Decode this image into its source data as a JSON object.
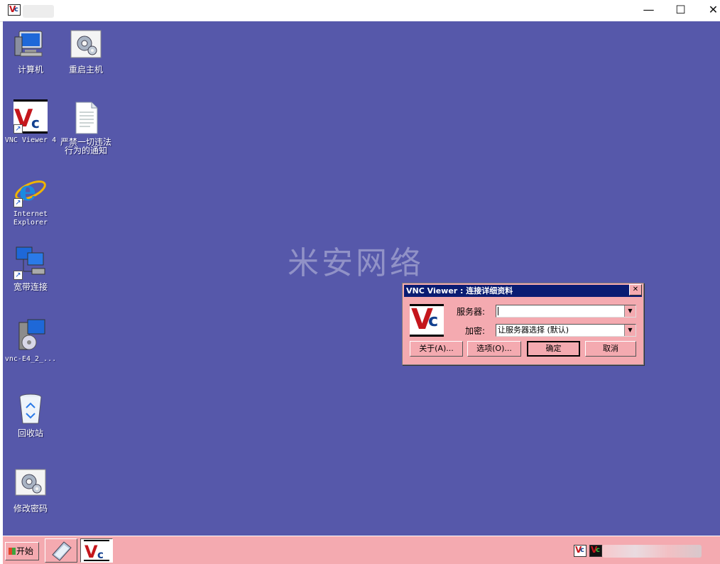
{
  "desktop_icons": [
    {
      "name": "computer",
      "label": "计算机"
    },
    {
      "name": "restart-host",
      "label": "重启主机"
    },
    {
      "name": "vnc-viewer",
      "label": "VNC Viewer 4"
    },
    {
      "name": "notice",
      "label_line1": "严禁一切违法",
      "label_line2": "行为的通知"
    },
    {
      "name": "internet-explorer",
      "label_line1": "Internet",
      "label_line2": "Explorer"
    },
    {
      "name": "broadband",
      "label": "宽带连接"
    },
    {
      "name": "vnc-installer",
      "label": "vnc-E4_2_..."
    },
    {
      "name": "recycle-bin",
      "label": "回收站"
    },
    {
      "name": "change-password",
      "label": "修改密码"
    }
  ],
  "watermark": "米安网络",
  "dialog": {
    "title": "VNC Viewer : 连接详细资料",
    "close": "✕",
    "server_label": "服务器:",
    "server_value": "",
    "encryption_label": "加密:",
    "encryption_value": "让服务器选择 (默认)",
    "about_button": "关于(A)...",
    "options_button": "选项(O)...",
    "ok_button": "确定",
    "cancel_button": "取消"
  },
  "taskbar": {
    "start_label": "开始"
  },
  "window_controls": {
    "minimize": "—",
    "maximize": "☐",
    "close": "✕"
  },
  "logo": {
    "v": "V",
    "c": "c"
  },
  "colors": {
    "desktop_bg": "#5658aa",
    "dialog_bg": "#f4aab0",
    "dialog_title_bg": "#0a1c72",
    "taskbar_bg": "#f4aab0"
  }
}
